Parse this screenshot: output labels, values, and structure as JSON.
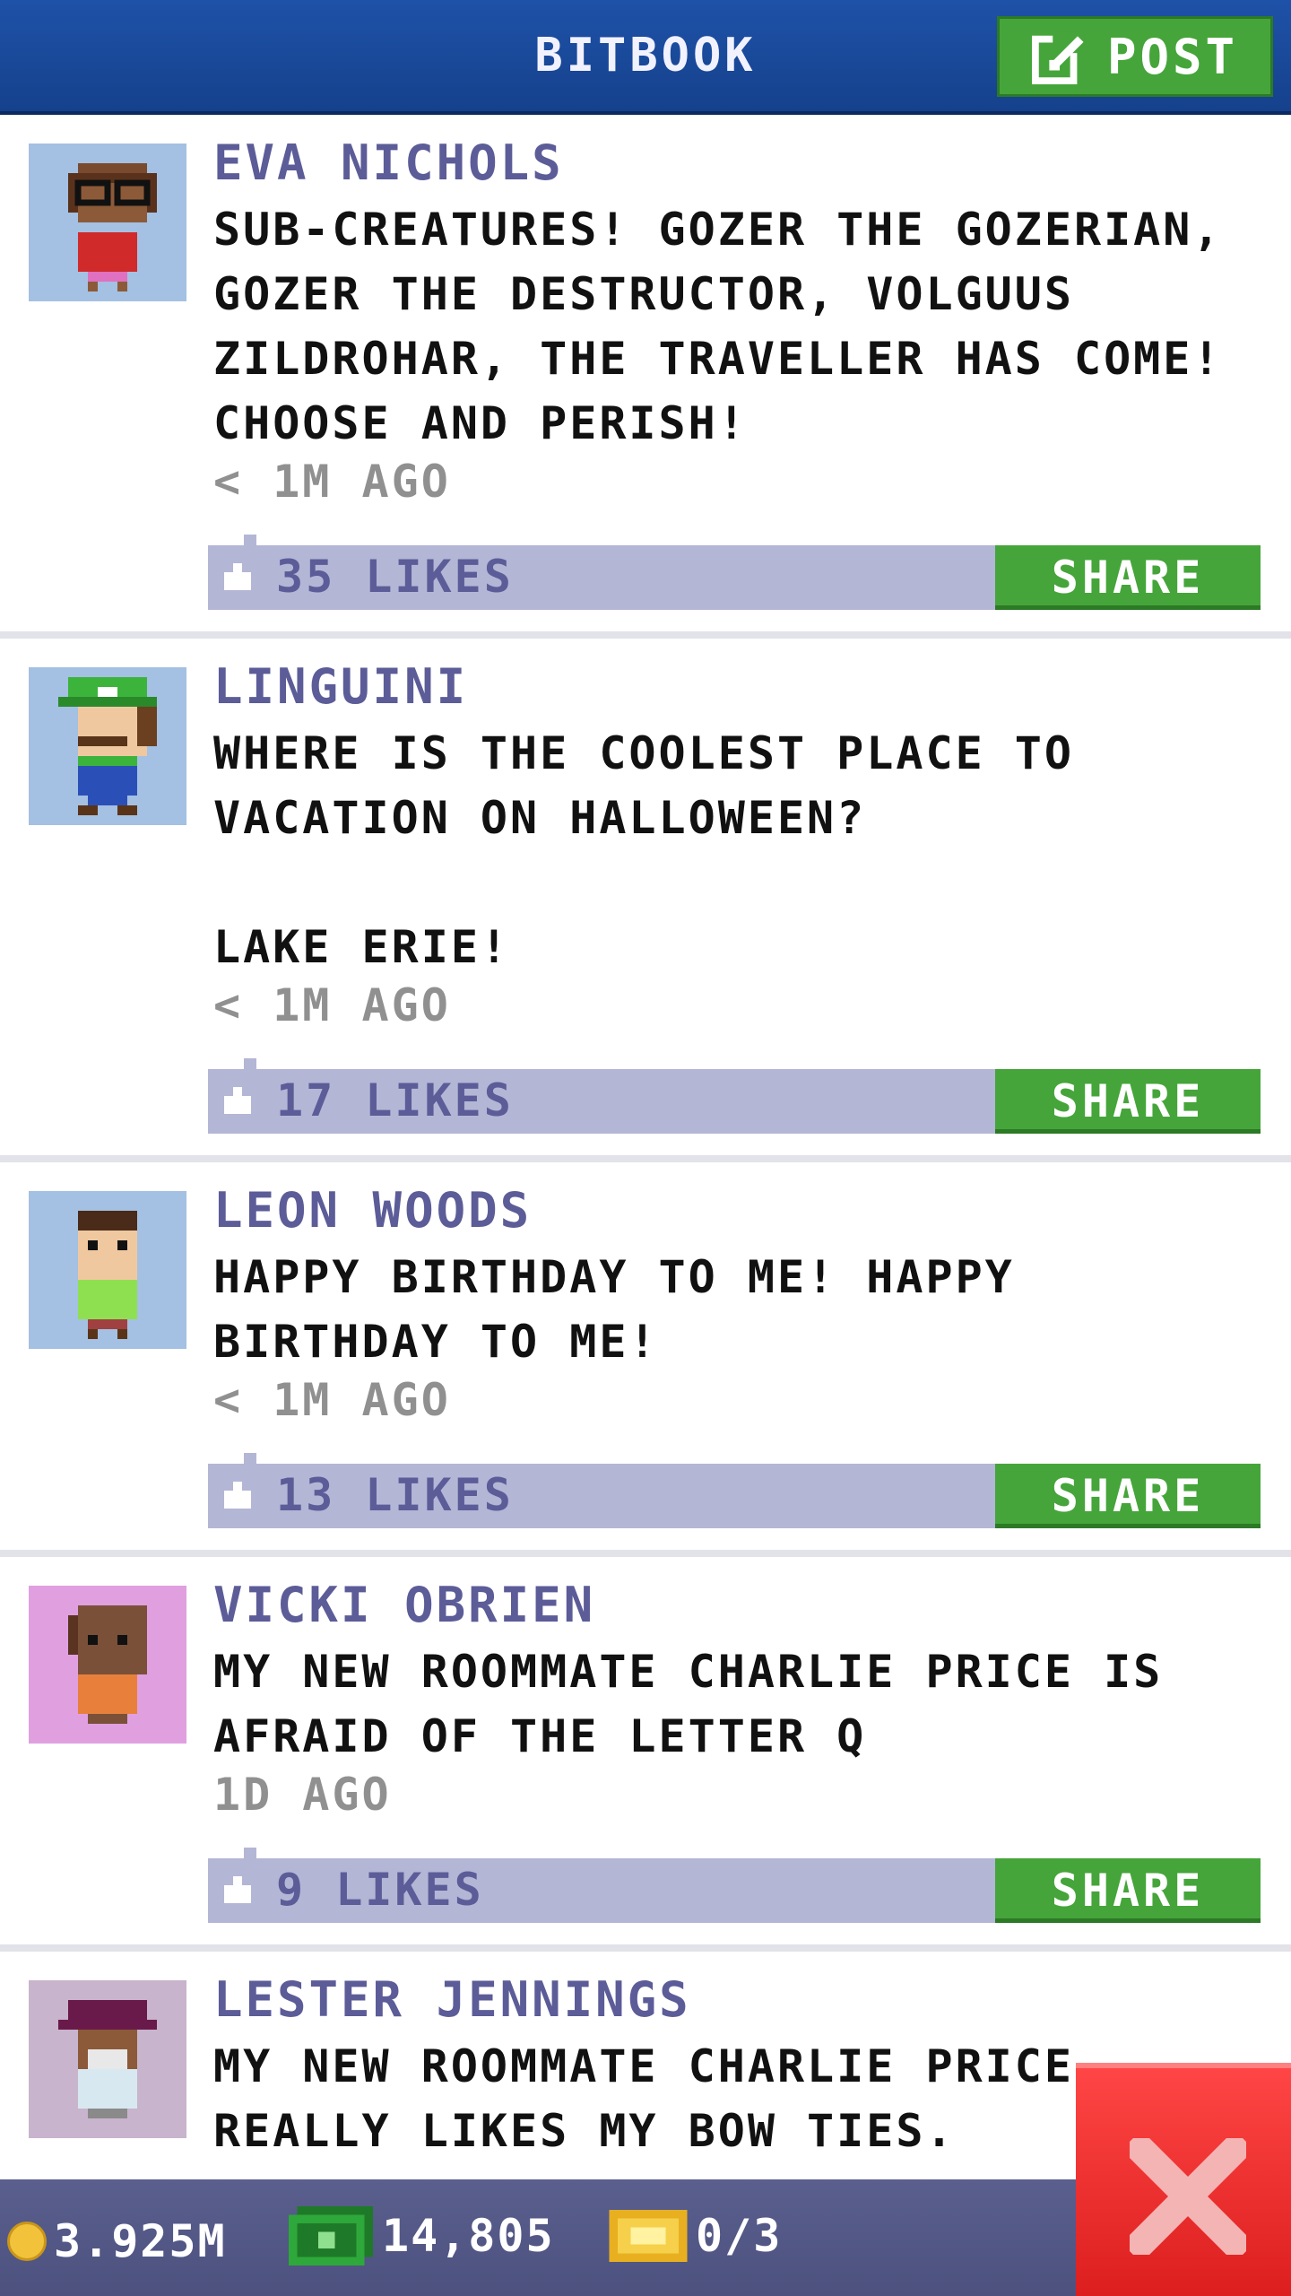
{
  "header": {
    "title": "BITBOOK",
    "post_label": "POST"
  },
  "posts": [
    {
      "author": "EVA NICHOLS",
      "text": "SUB-CREATURES! GOZER THE GOZERIAN,\nGOZER THE DESTRUCTOR, VOLGUUS\nZILDROHAR, THE TRAVELLER HAS COME!\nCHOOSE AND PERISH!",
      "time": "< 1M AGO",
      "likes": "35 LIKES",
      "share": "SHARE",
      "avatar_bg": "#a4c0e2"
    },
    {
      "author": "LINGUINI",
      "text": "WHERE IS THE COOLEST PLACE TO\nVACATION ON HALLOWEEN?\n\nLAKE ERIE!",
      "time": "< 1M AGO",
      "likes": "17 LIKES",
      "share": "SHARE",
      "avatar_bg": "#a4c0e2"
    },
    {
      "author": "LEON WOODS",
      "text": "HAPPY BIRTHDAY TO ME! HAPPY\nBIRTHDAY TO ME!",
      "time": "< 1M AGO",
      "likes": "13 LIKES",
      "share": "SHARE",
      "avatar_bg": "#a4c0e2"
    },
    {
      "author": "VICKI OBRIEN",
      "text": "MY NEW ROOMMATE CHARLIE PRICE IS\nAFRAID OF THE LETTER Q",
      "time": "1D AGO",
      "likes": "9 LIKES",
      "share": "SHARE",
      "avatar_bg": "#e0a0e0"
    },
    {
      "author": "LESTER JENNINGS",
      "text": "MY NEW ROOMMATE CHARLIE PRICE\nREALLY LIKES MY BOW TIES.",
      "time": "",
      "likes": "",
      "share": "",
      "avatar_bg": "#c8b4cc"
    }
  ],
  "status": {
    "coins": "3.925M",
    "bux": "14,805",
    "tickets": "0/3"
  },
  "icons": [
    "edit-icon",
    "coin-icon",
    "bux-icon",
    "ticket-icon",
    "close-icon",
    "thumb-icon"
  ],
  "colors": {
    "header": "#1e52a8",
    "share_green": "#45a53a",
    "likes_bar": "#b4b6d6",
    "close_red": "#e02a2a"
  }
}
